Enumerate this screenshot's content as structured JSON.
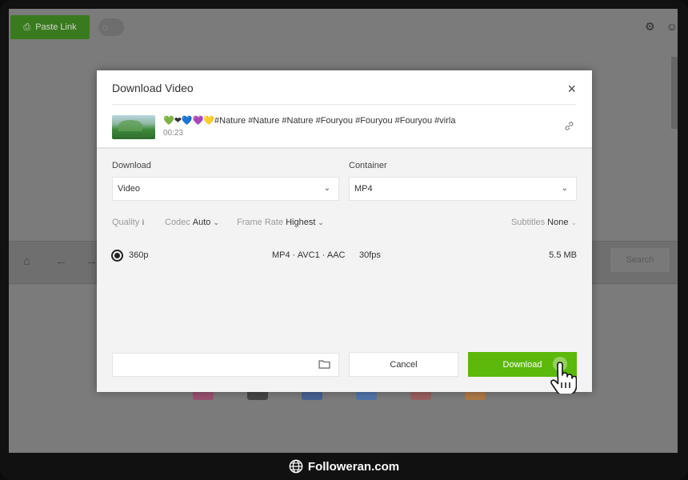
{
  "app": {
    "paste_link_label": "Paste Link",
    "search_label": "Search"
  },
  "dialog": {
    "title": "Download Video",
    "close_glyph": "×",
    "video": {
      "title": "💚❤💙💜💛#Nature #Nature #Nature #Fouryou #Fouryou #Fouryou #virla",
      "duration": "00:23"
    },
    "download_label": "Download",
    "download_value": "Video",
    "container_label": "Container",
    "container_value": "MP4",
    "options": {
      "quality_label": "Quality",
      "codec_label": "Codec",
      "codec_value": "Auto",
      "frame_rate_label": "Frame Rate",
      "frame_rate_value": "Highest",
      "subtitles_label": "Subtitles",
      "subtitles_value": "None"
    },
    "quality_item": {
      "resolution": "360p",
      "format": "MP4 · AVC1 · AAC",
      "fps": "30fps",
      "size": "5.5 MB"
    },
    "save_path_value": "",
    "cancel_label": "Cancel",
    "download_button_label": "Download"
  },
  "footer": {
    "watermark": "Followeran.com"
  },
  "colors": {
    "accent_green": "#5cb80b",
    "dimmed_green": "#3a7a1f"
  },
  "icons": [
    "link-icon",
    "bulb-icon",
    "settings-icon",
    "user-icon",
    "home-icon",
    "back-icon",
    "forward-icon",
    "folder-icon",
    "hand-cursor-icon",
    "globe-icon",
    "info-icon",
    "chevron-down-icon"
  ]
}
